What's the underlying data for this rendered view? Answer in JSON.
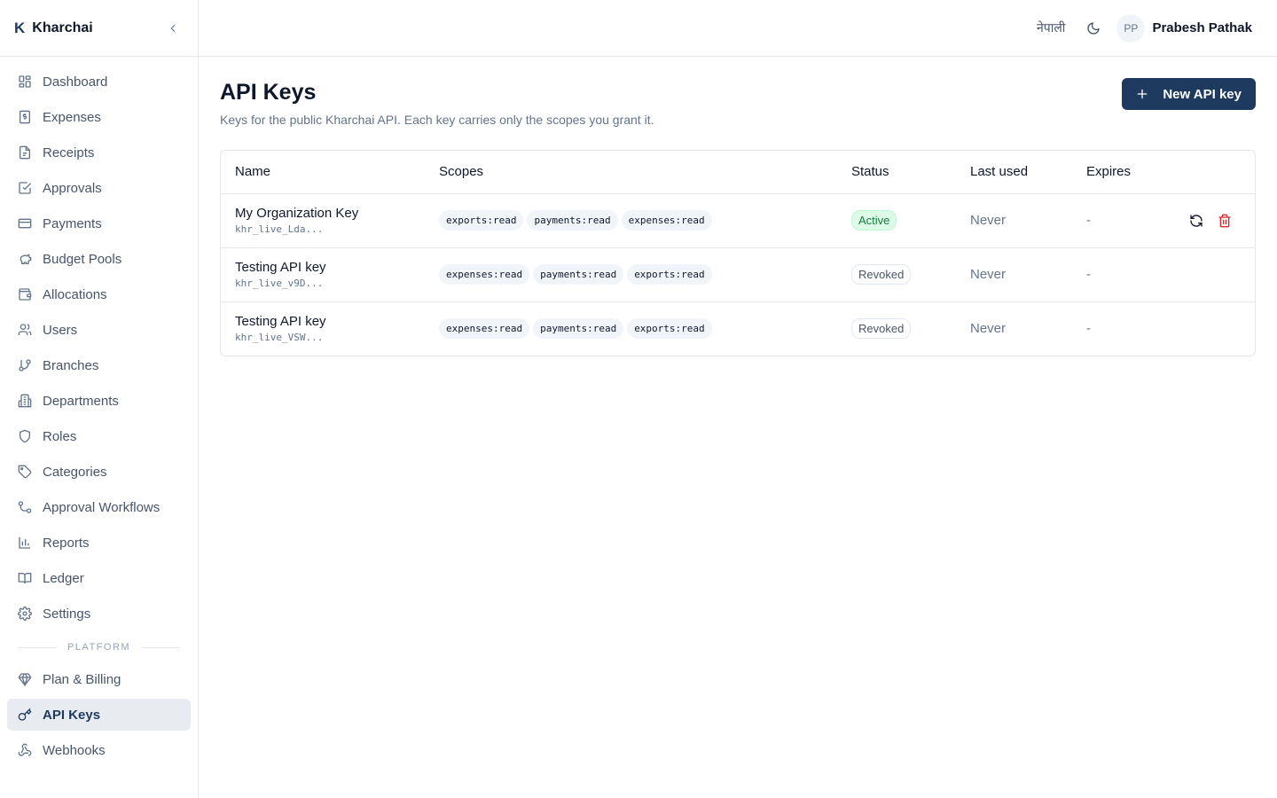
{
  "brand": {
    "mark": "K",
    "name": "Kharchai"
  },
  "sidebar": {
    "items": [
      {
        "label": "Dashboard",
        "icon": "dashboard-icon"
      },
      {
        "label": "Expenses",
        "icon": "receipt-dollar-icon"
      },
      {
        "label": "Receipts",
        "icon": "file-receipt-icon"
      },
      {
        "label": "Approvals",
        "icon": "check-square-icon"
      },
      {
        "label": "Payments",
        "icon": "credit-card-icon"
      },
      {
        "label": "Budget Pools",
        "icon": "piggy-bank-icon"
      },
      {
        "label": "Allocations",
        "icon": "wallet-icon"
      },
      {
        "label": "Users",
        "icon": "users-icon"
      },
      {
        "label": "Branches",
        "icon": "git-branch-icon"
      },
      {
        "label": "Departments",
        "icon": "building-icon"
      },
      {
        "label": "Roles",
        "icon": "shield-icon"
      },
      {
        "label": "Categories",
        "icon": "tag-icon"
      },
      {
        "label": "Approval Workflows",
        "icon": "workflow-icon"
      },
      {
        "label": "Reports",
        "icon": "bar-chart-icon"
      },
      {
        "label": "Ledger",
        "icon": "book-open-icon"
      },
      {
        "label": "Settings",
        "icon": "gear-icon"
      }
    ],
    "section_label": "PLATFORM",
    "platform_items": [
      {
        "label": "Plan & Billing",
        "icon": "gem-icon",
        "active": false
      },
      {
        "label": "API Keys",
        "icon": "key-icon",
        "active": true
      },
      {
        "label": "Webhooks",
        "icon": "webhook-icon",
        "active": false
      }
    ]
  },
  "topbar": {
    "language": "नेपाली",
    "theme_icon": "moon-icon",
    "avatar_initials": "PP",
    "user_name": "Prabesh Pathak"
  },
  "page": {
    "title": "API Keys",
    "description": "Keys for the public Kharchai API. Each key carries only the scopes you grant it.",
    "new_button": "New API key"
  },
  "table": {
    "headers": {
      "name": "Name",
      "scopes": "Scopes",
      "status": "Status",
      "last_used": "Last used",
      "expires": "Expires"
    },
    "rows": [
      {
        "name": "My Organization Key",
        "prefix": "khr_live_Lda...",
        "scopes": [
          "exports:read",
          "payments:read",
          "expenses:read"
        ],
        "status": "Active",
        "last_used": "Never",
        "expires": "-",
        "actions": true
      },
      {
        "name": "Testing API key",
        "prefix": "khr_live_v9D...",
        "scopes": [
          "expenses:read",
          "payments:read",
          "exports:read"
        ],
        "status": "Revoked",
        "last_used": "Never",
        "expires": "-",
        "actions": false
      },
      {
        "name": "Testing API key",
        "prefix": "khr_live_VSW...",
        "scopes": [
          "expenses:read",
          "payments:read",
          "exports:read"
        ],
        "status": "Revoked",
        "last_used": "Never",
        "expires": "-",
        "actions": false
      }
    ]
  },
  "colors": {
    "accent": "#1e3a5f",
    "active_badge_bg": "#dcfce7",
    "active_badge_text": "#15803d",
    "danger": "#dc2626"
  }
}
